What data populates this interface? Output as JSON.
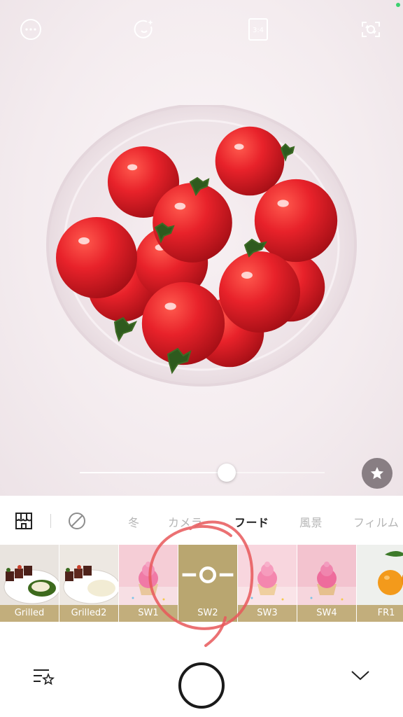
{
  "camera": {
    "icons": {
      "more": "more-icon",
      "beauty": "beauty-icon",
      "ratio": "3:4",
      "flip": "flip-camera-icon"
    },
    "intensity": 0.6,
    "favorite_icon": "star-icon"
  },
  "categories": {
    "store_icon": "store-icon",
    "none_icon": "no-filter-icon",
    "tabs": [
      {
        "label": "冬",
        "active": false
      },
      {
        "label": "カメラ",
        "active": false
      },
      {
        "label": "フード",
        "active": true
      },
      {
        "label": "風景",
        "active": false
      },
      {
        "label": "フィルム",
        "active": false
      }
    ]
  },
  "filters": [
    {
      "label": "Grilled",
      "thumb": "steak"
    },
    {
      "label": "Grilled2",
      "thumb": "steak"
    },
    {
      "label": "SW1",
      "thumb": "cupcake"
    },
    {
      "label": "SW2",
      "thumb": "selected",
      "selected": true
    },
    {
      "label": "SW3",
      "thumb": "cupcake"
    },
    {
      "label": "SW4",
      "thumb": "cupcake"
    },
    {
      "label": "FR1",
      "thumb": "orange"
    }
  ],
  "bottom": {
    "favorites_icon": "favorites-list-icon",
    "shutter": "shutter-button",
    "collapse_icon": "chevron-down-icon"
  },
  "colors": {
    "filter_label_bg": "#c2ae7c",
    "selected_bg": "#b9a670",
    "annotation": "#e8585a"
  }
}
